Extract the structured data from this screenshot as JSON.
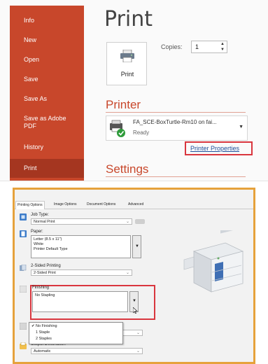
{
  "backstage": {
    "sidebar": {
      "items": [
        {
          "label": "Info"
        },
        {
          "label": "New"
        },
        {
          "label": "Open"
        },
        {
          "label": "Save"
        },
        {
          "label": "Save As"
        },
        {
          "label": "Save as Adobe PDF"
        },
        {
          "label": "History"
        },
        {
          "label": "Print"
        }
      ],
      "active": "Print"
    },
    "title": "Print",
    "print_button_label": "Print",
    "copies_label": "Copies:",
    "copies_value": "1",
    "printer_section": "Printer",
    "printer_name": "FA_SCE-BoxTurtle-Rm10 on fai...",
    "printer_status": "Ready",
    "printer_properties_link": "Printer Properties",
    "settings_section": "Settings"
  },
  "dialog": {
    "tabs": [
      "Printing Options",
      "Image Options",
      "Document Options",
      "Advanced"
    ],
    "active_tab": "Printing Options",
    "job_type_label": "Job Type:",
    "job_type_value": "Normal Print",
    "paper_label": "Paper:",
    "paper_lines": [
      "Letter (8.5 x 11\")",
      "White",
      "Printer Default Type"
    ],
    "two_sided_label": "2-Sided Printing",
    "two_sided_value": "2-Sided Print",
    "finishing_label": "Finishing",
    "finishing_value": "No Stapling",
    "finishing_options": [
      "No Finishing",
      "1 Staple",
      "2 Staples"
    ],
    "finishing_selected": "No Finishing",
    "output_destination_label": "Output Destination",
    "output_destination_value": "Automatic"
  },
  "colors": {
    "accent": "#c8472b",
    "highlight_border": "#d9363e",
    "screenshot_border": "#e6a23c",
    "link": "#1f4e9a"
  }
}
